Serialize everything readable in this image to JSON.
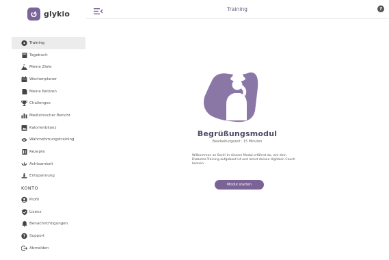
{
  "app": {
    "name": "glykio"
  },
  "header": {
    "title": "Training",
    "help_glyph": "?"
  },
  "sidebar": {
    "items": [
      {
        "label": "Training",
        "icon": "play-circle-icon",
        "active": true
      },
      {
        "label": "Tagebuch",
        "icon": "book-icon"
      },
      {
        "label": "Meine Ziele",
        "icon": "mountain-flag-icon"
      },
      {
        "label": "Wochenplaner",
        "icon": "calendar-icon"
      },
      {
        "label": "Meine Notizen",
        "icon": "note-icon"
      },
      {
        "label": "Challenges",
        "icon": "trophy-icon"
      },
      {
        "label": "Medizinischer Bericht",
        "icon": "bar-chart-icon"
      },
      {
        "label": "Kalorienbilanz",
        "icon": "scale-image-icon"
      },
      {
        "label": "Wahrnehmungstraining",
        "icon": "eye-icon"
      },
      {
        "label": "Rezepte",
        "icon": "recipe-icon"
      },
      {
        "label": "Achtsamkeit",
        "icon": "lotus-icon"
      },
      {
        "label": "Entspannung",
        "icon": "relax-icon"
      }
    ],
    "section_title": "KONTO",
    "account_items": [
      {
        "label": "Profil",
        "icon": "user-circle-icon"
      },
      {
        "label": "Lizenz",
        "icon": "shield-check-icon"
      },
      {
        "label": "Benachrichtigungen",
        "icon": "bell-icon"
      },
      {
        "label": "Support",
        "icon": "question-circle-icon"
      },
      {
        "label": "Abmelden",
        "icon": "logout-icon"
      }
    ]
  },
  "main": {
    "title": "Begrüßungsmodul",
    "duration": "Bearbeitungszeit : 15 Minuten",
    "description": "Willkommen an Bord! In diesem Modul erfährst du, wie dein Diabetes-Training aufgebaut ist und lernst deinen digitalen Coach kennen.",
    "button_label": "Modul starten"
  },
  "colors": {
    "accent": "#7a6497",
    "hero": "#8b77a6",
    "active_bg": "#ececec"
  }
}
